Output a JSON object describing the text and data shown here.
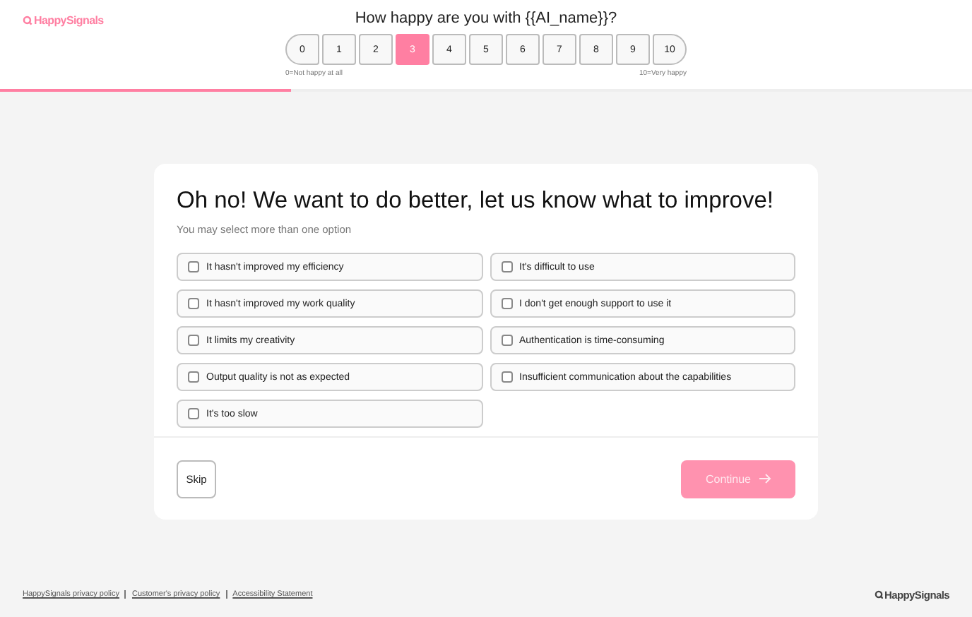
{
  "header": {
    "logo": "HappySignals",
    "question": "How happy are you with {{AI_name}}?",
    "scale": [
      {
        "label": "0",
        "selected": false
      },
      {
        "label": "1",
        "selected": false
      },
      {
        "label": "2",
        "selected": false
      },
      {
        "label": "3",
        "selected": true
      },
      {
        "label": "4",
        "selected": false
      },
      {
        "label": "5",
        "selected": false
      },
      {
        "label": "6",
        "selected": false
      },
      {
        "label": "7",
        "selected": false
      },
      {
        "label": "8",
        "selected": false
      },
      {
        "label": "9",
        "selected": false
      },
      {
        "label": "10",
        "selected": false
      }
    ],
    "low_label": "0=Not happy at all",
    "high_label": "10=Very happy",
    "progress": {
      "level": 0.3
    }
  },
  "card": {
    "title": "Oh no! We want to do better, let us know what to improve!",
    "subtitle": "You may select more than one option",
    "options": [
      {
        "label": "It hasn't improved my efficiency",
        "checked": false
      },
      {
        "label": "It's difficult to use",
        "checked": false
      },
      {
        "label": "It hasn't improved my work quality",
        "checked": false
      },
      {
        "label": "I don't get enough support to use it",
        "checked": false
      },
      {
        "label": "It limits my creativity",
        "checked": false
      },
      {
        "label": "Authentication is time-consuming",
        "checked": false
      },
      {
        "label": "Output quality is not as expected",
        "checked": false
      },
      {
        "label": "Insufficient communication about the capabilities",
        "checked": false
      },
      {
        "label": "It's too slow",
        "checked": false
      }
    ],
    "skip": "Skip",
    "continue": {
      "label": "Continue",
      "disabled": true
    }
  },
  "footer": {
    "links": [
      "HappySignals privacy policy",
      "Customer's privacy policy",
      "Accessibility Statement"
    ],
    "logo": "HappySignals"
  }
}
